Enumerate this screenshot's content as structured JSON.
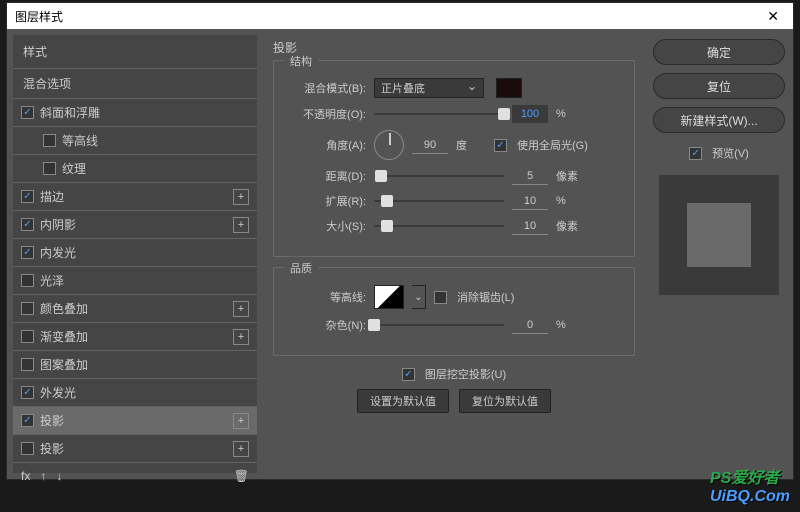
{
  "title": "图层样式",
  "sidebar": {
    "header": "样式",
    "sub": "混合选项",
    "items": [
      {
        "label": "斜面和浮雕",
        "checked": true,
        "plus": false,
        "child": false
      },
      {
        "label": "等高线",
        "checked": false,
        "plus": false,
        "child": true
      },
      {
        "label": "纹理",
        "checked": false,
        "plus": false,
        "child": true
      },
      {
        "label": "描边",
        "checked": true,
        "plus": true,
        "child": false
      },
      {
        "label": "内阴影",
        "checked": true,
        "plus": true,
        "child": false
      },
      {
        "label": "内发光",
        "checked": true,
        "plus": false,
        "child": false
      },
      {
        "label": "光泽",
        "checked": false,
        "plus": false,
        "child": false
      },
      {
        "label": "颜色叠加",
        "checked": false,
        "plus": true,
        "child": false
      },
      {
        "label": "渐变叠加",
        "checked": false,
        "plus": true,
        "child": false
      },
      {
        "label": "图案叠加",
        "checked": false,
        "plus": false,
        "child": false
      },
      {
        "label": "外发光",
        "checked": true,
        "plus": false,
        "child": false
      },
      {
        "label": "投影",
        "checked": true,
        "plus": true,
        "child": false,
        "active": true
      },
      {
        "label": "投影",
        "checked": false,
        "plus": true,
        "child": false
      }
    ],
    "footer_fx": "fx"
  },
  "main": {
    "title": "投影",
    "structure": {
      "legend": "结构",
      "blend_label": "混合模式(B):",
      "blend_value": "正片叠底",
      "opacity_label": "不透明度(O):",
      "opacity_value": "100",
      "opacity_unit": "%",
      "angle_label": "角度(A):",
      "angle_value": "90",
      "angle_unit": "度",
      "global_light": "使用全局光(G)",
      "distance_label": "距离(D):",
      "distance_value": "5",
      "distance_unit": "像素",
      "spread_label": "扩展(R):",
      "spread_value": "10",
      "spread_unit": "%",
      "size_label": "大小(S):",
      "size_value": "10",
      "size_unit": "像素"
    },
    "quality": {
      "legend": "品质",
      "contour_label": "等高线:",
      "antialias": "消除锯齿(L)",
      "noise_label": "杂色(N):",
      "noise_value": "0",
      "noise_unit": "%"
    },
    "knockout": "图层挖空投影(U)",
    "set_default": "设置为默认值",
    "reset_default": "复位为默认值"
  },
  "right": {
    "ok": "确定",
    "cancel": "复位",
    "new_style": "新建样式(W)...",
    "preview": "预览(V)"
  },
  "watermark": {
    "ps": "PS",
    "suffix": "爱好者",
    "uib": "UiBQ.Com"
  }
}
